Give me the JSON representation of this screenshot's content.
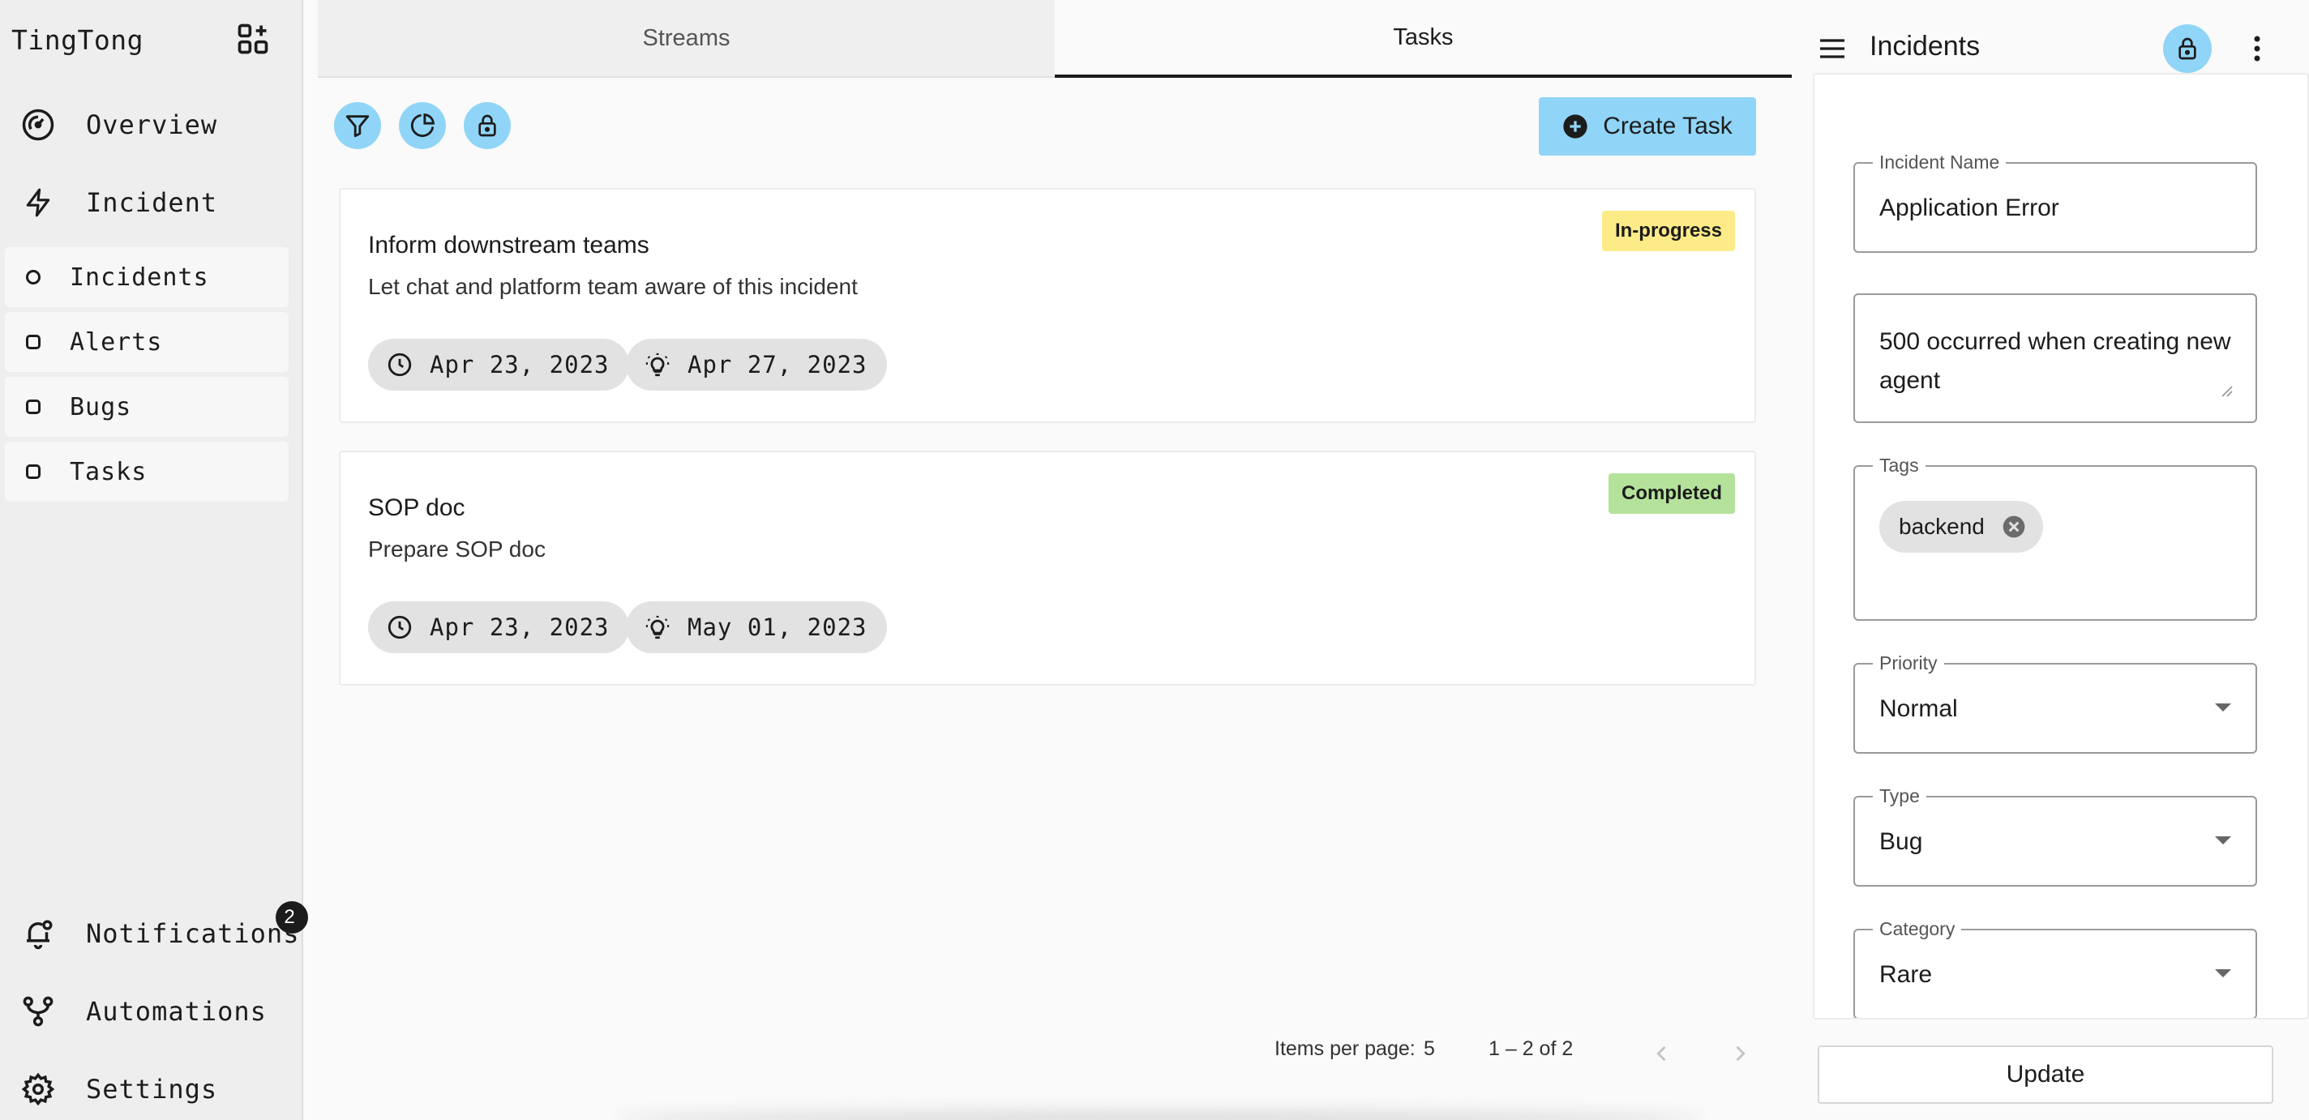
{
  "app": {
    "brand": "TingTong"
  },
  "sidebar": {
    "nav": [
      {
        "label": "Overview",
        "icon": "speedometer-icon"
      },
      {
        "label": "Incident",
        "icon": "bolt-icon"
      }
    ],
    "sub_items": [
      {
        "label": "Incidents"
      },
      {
        "label": "Alerts"
      },
      {
        "label": "Bugs"
      },
      {
        "label": "Tasks"
      }
    ],
    "bottom": [
      {
        "label": "Notifications",
        "icon": "bell-icon",
        "badge": "2"
      },
      {
        "label": "Automations",
        "icon": "workflow-icon"
      },
      {
        "label": "Settings",
        "icon": "gear-icon"
      }
    ]
  },
  "main": {
    "tabs": [
      {
        "label": "Streams",
        "active": false
      },
      {
        "label": "Tasks",
        "active": true
      }
    ],
    "toolbar": {
      "create_label": "Create Task"
    },
    "tasks": [
      {
        "title": "Inform downstream teams",
        "description": "Let chat and platform team aware of this incident",
        "status": "In-progress",
        "status_color": "#fdeb88",
        "start": "Apr 23, 2023",
        "due": "Apr 27, 2023"
      },
      {
        "title": "SOP doc",
        "description": "Prepare SOP doc",
        "status": "Completed",
        "status_color": "#b4e29a",
        "start": "Apr 23, 2023",
        "due": "May 01, 2023"
      }
    ],
    "pagination": {
      "items_per_page_label": "Items per page:",
      "items_per_page": "5",
      "range": "1 – 2 of 2"
    }
  },
  "panel": {
    "title": "Incidents",
    "fields": {
      "name": {
        "label": "Incident Name",
        "value": "Application Error"
      },
      "description": {
        "value": "500 occurred when creating new agent"
      },
      "tags": {
        "label": "Tags",
        "items": [
          "backend"
        ]
      },
      "priority": {
        "label": "Priority",
        "value": "Normal"
      },
      "type": {
        "label": "Type",
        "value": "Bug"
      },
      "category": {
        "label": "Category",
        "value": "Rare"
      }
    },
    "update_label": "Update"
  },
  "colors": {
    "accent": "#90d5f7",
    "sidebar_bg": "#eeeeee"
  }
}
